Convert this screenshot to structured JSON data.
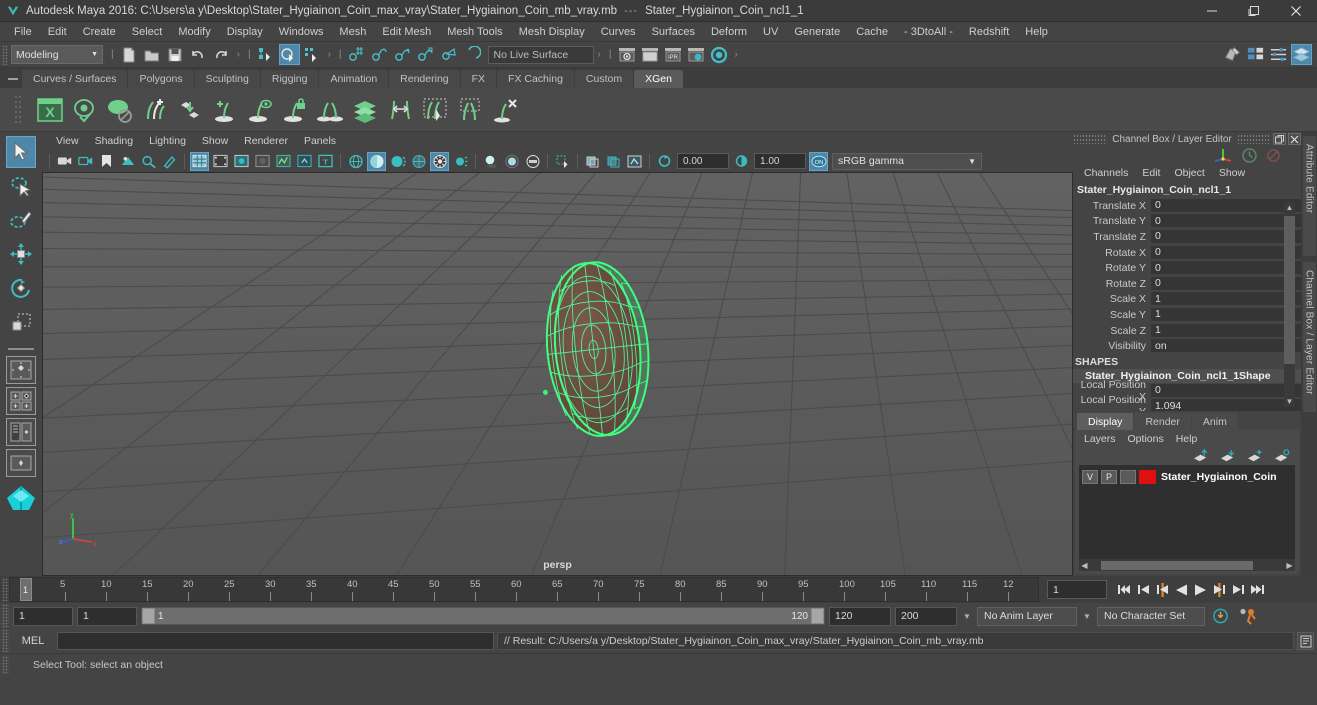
{
  "titlebar": {
    "app_title": "Autodesk Maya 2016: C:\\Users\\a y\\Desktop\\Stater_Hygiainon_Coin_max_vray\\Stater_Hygiainon_Coin_mb_vray.mb",
    "separator": "---",
    "selected_object": "Stater_Hygiainon_Coin_ncl1_1",
    "minimize": "─",
    "maximize": "❐",
    "close": "✕"
  },
  "menubar": {
    "items": [
      "File",
      "Edit",
      "Create",
      "Select",
      "Modify",
      "Display",
      "Windows",
      "Mesh",
      "Edit Mesh",
      "Mesh Tools",
      "Mesh Display",
      "Curves",
      "Surfaces",
      "Deform",
      "UV",
      "Generate",
      "Cache",
      "- 3DtoAll -",
      "Redshift",
      "Help"
    ]
  },
  "statusbar": {
    "mode": "Modeling",
    "live_surface": "No Live Surface",
    "icons": [
      "new-scene-icon",
      "open-scene-icon",
      "save-scene-icon",
      "undo-icon",
      "redo-icon",
      "select-by-hierarchy-icon",
      "select-by-object-icon",
      "select-by-component-icon",
      "snap-to-grid-icon",
      "snap-to-curve-icon",
      "snap-to-point-icon",
      "snap-to-projected-center-icon",
      "snap-to-view-plane-icon",
      "make-live-icon",
      "render-current-frame-icon",
      "ipr-render-icon",
      "render-settings-icon",
      "hypershade-icon",
      "render-view-icon"
    ],
    "right_icons": [
      "show-hide-modeling-toolkit-icon",
      "show-hide-attribute-editor-icon",
      "show-hide-tool-settings-icon",
      "show-hide-channel-box-icon"
    ]
  },
  "shelf": {
    "tabs": [
      "Curves / Surfaces",
      "Polygons",
      "Sculpting",
      "Rigging",
      "Animation",
      "Rendering",
      "FX",
      "FX Caching",
      "Custom",
      "XGen"
    ],
    "active_tab": "XGen",
    "icons": [
      "xgen-editor-icon",
      "xgen-preview-icon",
      "xgen-disable-preview-icon",
      "xgen-add-description-icon",
      "xgen-import-collection-icon",
      "xgen-add-guide-icon",
      "xgen-guide-visibility-icon",
      "xgen-lock-guide-icon",
      "xgen-guide-tools-icon",
      "xgen-groom-layers-icon",
      "xgen-move-guides-icon",
      "xgen-select-guides-icon",
      "xgen-mask-tool-icon",
      "xgen-delete-guides-icon"
    ]
  },
  "toolbox": {
    "tools": [
      "select-tool",
      "lasso-select-tool",
      "paint-select-tool",
      "move-tool",
      "rotate-tool",
      "scale-tool"
    ],
    "layout_buttons": [
      "single-perspective-layout",
      "four-view-layout",
      "persp-outliner-layout",
      "persp-graph-layout",
      "hypershade-layout"
    ]
  },
  "viewport": {
    "menus": [
      "View",
      "Shading",
      "Lighting",
      "Show",
      "Renderer",
      "Panels"
    ],
    "camera_label": "persp",
    "exposure_value": "0.00",
    "gamma_value": "1.00",
    "color_management": "sRGB gamma",
    "toolbar_icons": [
      "select-camera-icon",
      "camera-attributes-icon",
      "bookmark-icon",
      "image-plane-icon",
      "two-d-pan-zoom-icon",
      "grease-pencil-icon",
      "grid-icon",
      "film-gate-icon",
      "resolution-gate-icon",
      "gate-mask-icon",
      "film-origin-icon",
      "xray-joints-icon",
      "texture-border-icon",
      "wireframe-icon",
      "smooth-shade-icon",
      "smooth-shade-lights-icon",
      "shaded-wireframe-icon",
      "textured-icon",
      "use-all-lights-icon",
      "shadows-icon",
      "screen-space-ao-icon",
      "motion-blur-icon",
      "multisample-icon",
      "isolate-select-icon",
      "xray-icon",
      "xray-active-components-icon",
      "xray-joints2-icon",
      "exposure-icon",
      "gamma-icon",
      "color-management-icon"
    ],
    "axis_labels": {
      "x": "x",
      "y": "y",
      "z": "z"
    }
  },
  "channelbox": {
    "panel_title": "Channel Box / Layer Editor",
    "menus": [
      "Channels",
      "Edit",
      "Object",
      "Show"
    ],
    "object_name": "Stater_Hygiainon_Coin_ncl1_1",
    "transform_rows": [
      {
        "label": "Translate X",
        "value": "0"
      },
      {
        "label": "Translate Y",
        "value": "0"
      },
      {
        "label": "Translate Z",
        "value": "0"
      },
      {
        "label": "Rotate X",
        "value": "0"
      },
      {
        "label": "Rotate Y",
        "value": "0"
      },
      {
        "label": "Rotate Z",
        "value": "0"
      },
      {
        "label": "Scale X",
        "value": "1"
      },
      {
        "label": "Scale Y",
        "value": "1"
      },
      {
        "label": "Scale Z",
        "value": "1"
      },
      {
        "label": "Visibility",
        "value": "on"
      }
    ],
    "shapes_header": "SHAPES",
    "shape_name": "Stater_Hygiainon_Coin_ncl1_1Shape",
    "shape_rows": [
      {
        "label": "Local Position X",
        "value": "0"
      },
      {
        "label": "Local Position Y",
        "value": "1.094"
      }
    ]
  },
  "layer_editor": {
    "tabs": [
      "Display",
      "Render",
      "Anim"
    ],
    "active_tab": "Display",
    "menus": [
      "Layers",
      "Options",
      "Help"
    ],
    "toolbar_icons": [
      "move-layer-up-icon",
      "move-layer-down-icon",
      "new-layer-icon",
      "new-layer-from-selected-icon"
    ],
    "layers": [
      {
        "visibility": "V",
        "playback": "P",
        "third": "",
        "color": "#e01010",
        "name": "Stater_Hygiainon_Coin"
      }
    ]
  },
  "side_tabs": [
    "Attribute Editor",
    "Channel Box / Layer Editor"
  ],
  "timeline": {
    "ticks": [
      "5",
      "10",
      "15",
      "20",
      "25",
      "30",
      "35",
      "40",
      "45",
      "50",
      "55",
      "60",
      "65",
      "70",
      "75",
      "80",
      "85",
      "90",
      "95",
      "100",
      "105",
      "110",
      "115",
      "12"
    ],
    "current_frame_marker": "1",
    "current_frame_field": "1",
    "playback_buttons": [
      "go-to-start-icon",
      "step-back-keyframe-icon",
      "step-back-frame-icon",
      "play-backwards-icon",
      "play-forwards-icon",
      "step-forward-frame-icon",
      "step-forward-keyframe-icon",
      "go-to-end-icon"
    ]
  },
  "range": {
    "start_field": "1",
    "playback_start_field": "1",
    "bar_start_label": "1",
    "bar_end_label": "120",
    "playback_end_field": "120",
    "end_field": "200",
    "anim_layer": "No Anim Layer",
    "character_set": "No Character Set",
    "icons": [
      "auto-key-icon",
      "animation-preferences-icon"
    ]
  },
  "command_line": {
    "language_label": "MEL",
    "input_value": "",
    "result_text": "// Result: C:/Users/a y/Desktop/Stater_Hygiainon_Coin_max_vray/Stater_Hygiainon_Coin_mb_vray.mb",
    "script_editor_icon": "script-editor-icon"
  },
  "helpline": {
    "text": "Select Tool: select an object"
  },
  "colors": {
    "accent": "#4e87a8",
    "shelf_green": "#5fbd7e",
    "selection_green": "#3dff7d",
    "layer_red": "#e01010",
    "panel_bg": "#444444",
    "viewport_bg": "#5b5b5b"
  }
}
